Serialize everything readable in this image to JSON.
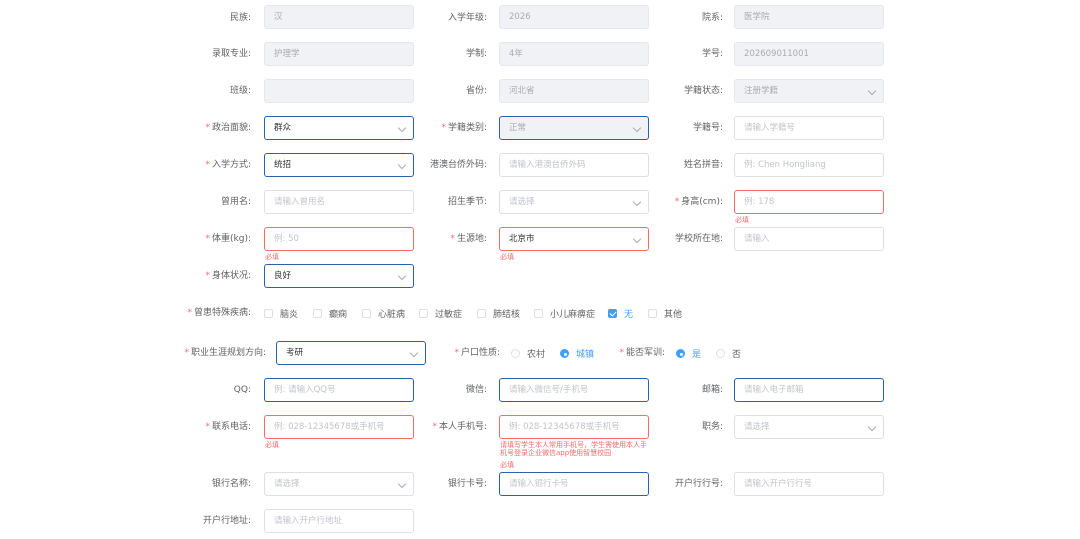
{
  "required_mark": "*",
  "fields": {
    "ethnicity": {
      "label": "民族:",
      "value": "汉"
    },
    "enroll_grade": {
      "label": "入学年级:",
      "value": "2026"
    },
    "department": {
      "label": "院系:",
      "value": "医学院"
    },
    "major": {
      "label": "录取专业:",
      "value": "护理学"
    },
    "schooling": {
      "label": "学制:",
      "value": "4年"
    },
    "student_no": {
      "label": "学号:",
      "value": "202609011001"
    },
    "class": {
      "label": "班级:",
      "value": ""
    },
    "province": {
      "label": "省份:",
      "value": "河北省"
    },
    "status_state": {
      "label": "学籍状态:",
      "value": "注册学籍"
    },
    "political": {
      "label": "政治面貌:",
      "value": "群众"
    },
    "status_type": {
      "label": "学籍类别:",
      "value": "正常"
    },
    "status_no": {
      "label": "学籍号:",
      "placeholder": "请输入学籍号"
    },
    "admission_mode": {
      "label": "入学方式:",
      "value": "统招"
    },
    "hkmt_code": {
      "label": "港澳台侨外码:",
      "placeholder": "请输入港澳台侨外码"
    },
    "pinyin": {
      "label": "姓名拼音:",
      "placeholder": "例: Chen Hongliang"
    },
    "former_name": {
      "label": "曾用名:",
      "placeholder": "请输入曾用名"
    },
    "season": {
      "label": "招生季节:",
      "placeholder": "请选择"
    },
    "height": {
      "label": "身高(cm):",
      "placeholder": "例: 178",
      "error": "必填"
    },
    "weight": {
      "label": "体重(kg):",
      "placeholder": "例: 50",
      "error": "必填"
    },
    "origin": {
      "label": "生源地:",
      "value": "北京市",
      "error": "必填"
    },
    "school_location": {
      "label": "学校所在地:",
      "placeholder": "请输入"
    },
    "health": {
      "label": "身体状况:",
      "value": "良好"
    },
    "diseases": {
      "label": "曾患特殊疾病:",
      "options": [
        "脑炎",
        "癫痫",
        "心脏病",
        "过敏症",
        "肺结核",
        "小儿麻痹症",
        "无",
        "其他"
      ],
      "checked": "无"
    },
    "career": {
      "label": "职业生涯规划方向:",
      "value": "考研"
    },
    "hukou": {
      "label": "户口性质:",
      "options": [
        "农村",
        "城镇"
      ],
      "selected": "城镇"
    },
    "military": {
      "label": "能否军训:",
      "options": [
        "是",
        "否"
      ],
      "selected": "是"
    },
    "qq": {
      "label": "QQ:",
      "placeholder": "例: 请输入QQ号"
    },
    "wechat": {
      "label": "微信:",
      "placeholder": "请输入微信号/手机号"
    },
    "email": {
      "label": "邮箱:",
      "placeholder": "请输入电子邮箱"
    },
    "contact_phone": {
      "label": "联系电话:",
      "placeholder": "例: 028-12345678或手机号",
      "error": "必填"
    },
    "own_phone": {
      "label": "本人手机号:",
      "placeholder": "例: 028-12345678或手机号",
      "hint": "请填写学生本人常用手机号，学生需使用本人手机号登录企业微信app使用智慧校园",
      "error": "必填"
    },
    "position": {
      "label": "职务:",
      "placeholder": "请选择"
    },
    "bank_name": {
      "label": "银行名称:",
      "placeholder": "请选择"
    },
    "bank_card": {
      "label": "银行卡号:",
      "placeholder": "请输入银行卡号"
    },
    "bank_branch_no": {
      "label": "开户行行号:",
      "placeholder": "请输入开户行行号"
    },
    "bank_branch_addr": {
      "label": "开户行地址:",
      "placeholder": "请输入开户行地址"
    }
  }
}
